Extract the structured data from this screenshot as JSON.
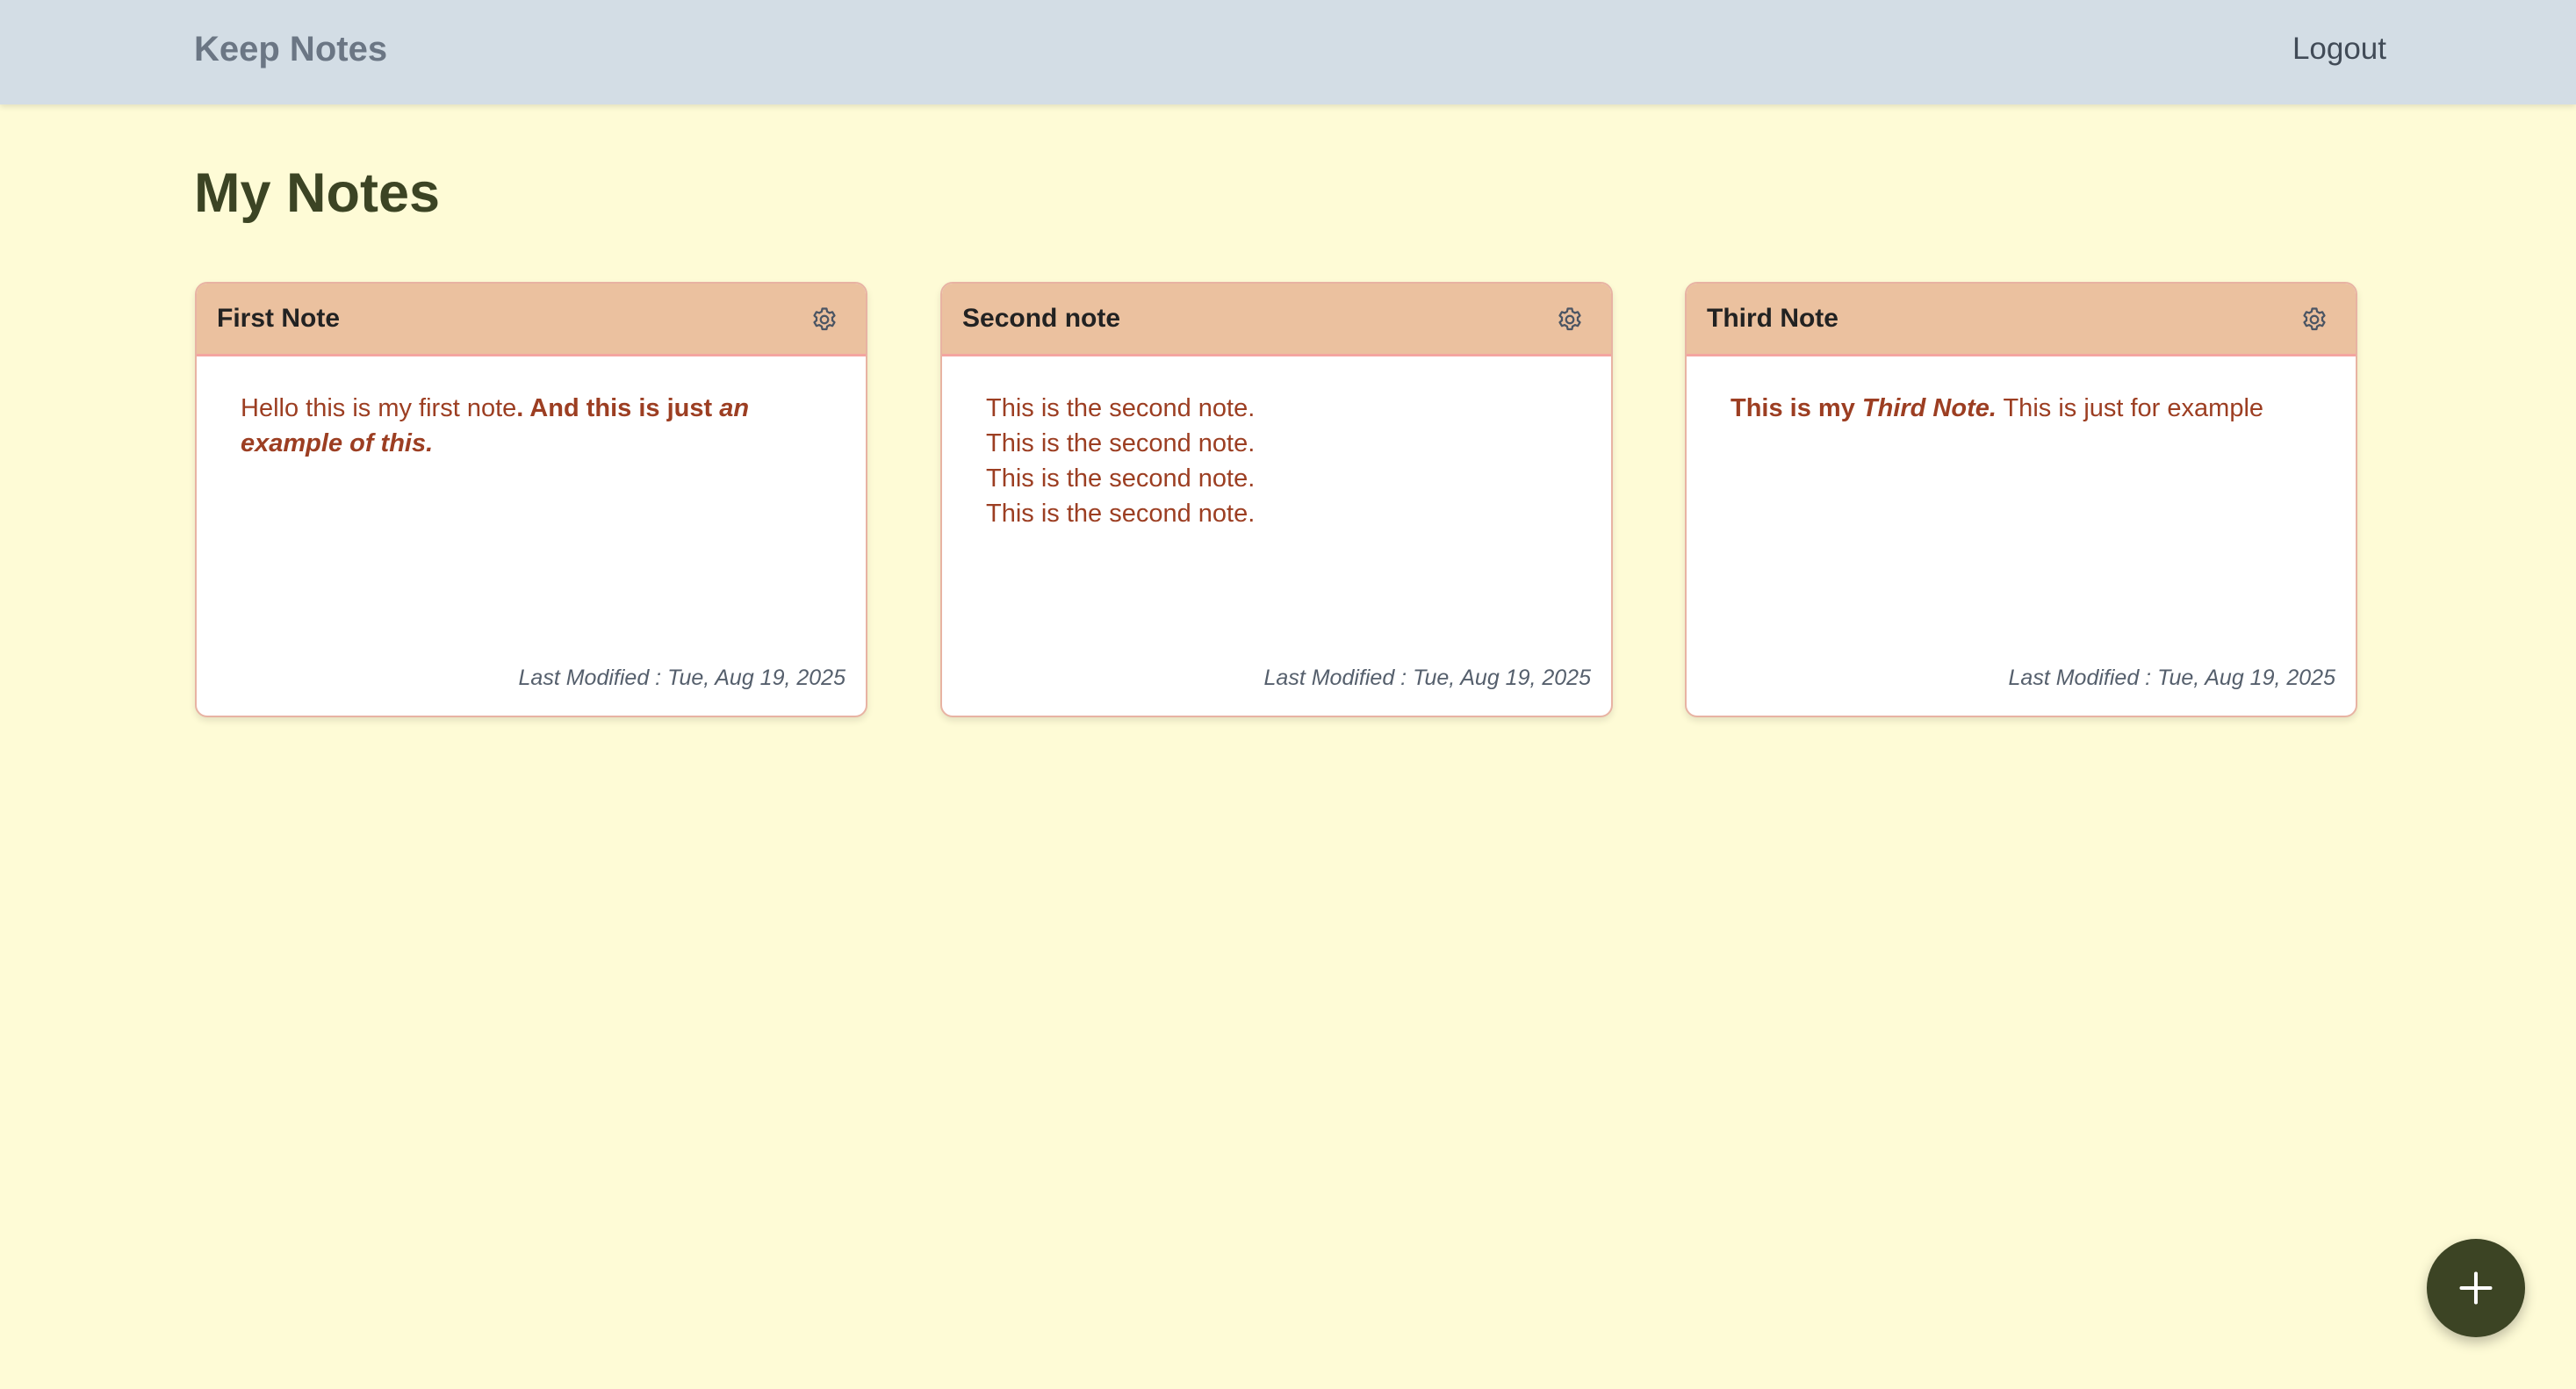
{
  "header": {
    "brand": "Keep Notes",
    "logout": "Logout"
  },
  "page_title": "My Notes",
  "notes": [
    {
      "title": "First Note",
      "settings_icon": "gear-icon",
      "content": [
        {
          "text": "Hello this is my first note",
          "style": "normal"
        },
        {
          "text": ". And this is just ",
          "style": "bold"
        },
        {
          "text": "an example of this.",
          "style": "bold-italic"
        }
      ],
      "last_modified": "Last Modified : Tue, Aug 19, 2025"
    },
    {
      "title": "Second note",
      "settings_icon": "gear-icon",
      "lines": [
        "This is the second note.",
        "This is the second note.",
        "This is the second note.",
        "This is the second note."
      ],
      "last_modified": "Last Modified : Tue, Aug 19, 2025"
    },
    {
      "title": "Third Note",
      "settings_icon": "gear-icon",
      "content": [
        {
          "text": "This is my ",
          "style": "bold"
        },
        {
          "text": "Third Note.",
          "style": "bold-italic"
        },
        {
          "text": " This is just for example",
          "style": "normal"
        }
      ],
      "last_modified": "Last Modified : Tue, Aug 19, 2025"
    }
  ],
  "fab": {
    "icon": "plus-icon"
  },
  "colors": {
    "header_bg": "#d3dde5",
    "page_bg": "#fefbd6",
    "card_header_bg": "#ebc19f",
    "note_text": "#9c3e22",
    "title_color": "#3c4424",
    "fab_bg": "#3c4424"
  }
}
